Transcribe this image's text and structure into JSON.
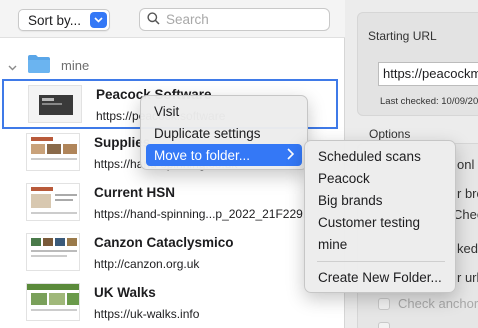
{
  "toolbar": {
    "sort_label": "Sort by...",
    "search_placeholder": "Search"
  },
  "group": {
    "name": "mine"
  },
  "items": [
    {
      "title": "Peacock Software",
      "url": "https://peacock.software"
    },
    {
      "title": "Supplies",
      "url": "https://hand-spinning.co.uk"
    },
    {
      "title": "Current HSN",
      "url": "https://hand-spinning...p_2022_21F229."
    },
    {
      "title": "Canzon Cataclysmico",
      "url": "http://canzon.org.uk"
    },
    {
      "title": "UK Walks",
      "url": "https://uk-walks.info"
    }
  ],
  "context_menu": {
    "visit": "Visit",
    "duplicate": "Duplicate settings",
    "move": "Move to folder..."
  },
  "folder_menu": {
    "folders": [
      "Scheduled scans",
      "Peacock",
      "Big brands",
      "Customer testing",
      "mine"
    ],
    "create": "Create New Folder..."
  },
  "right_panel": {
    "starting_url_label": "Starting URL",
    "starting_url_value": "https://peacockm",
    "last_checked": "Last checked: 10/09/20",
    "options_label": "Options",
    "fragments": [
      "onl",
      "r bro",
      "Chec",
      "ked",
      "r urls"
    ],
    "check_anchors": "Check anchor"
  },
  "colors": {
    "accent": "#3478f6",
    "selection_border": "#3f7ae8",
    "folder_blue": "#5aa6e8"
  }
}
